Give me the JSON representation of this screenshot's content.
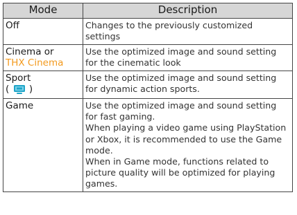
{
  "table": {
    "headers": {
      "mode": "Mode",
      "description": "Description"
    },
    "rows": [
      {
        "mode": "Off",
        "description": "Changes to the previously customized settings"
      },
      {
        "mode_line1": "Cinema or",
        "mode_line2": "THX Cinema",
        "description": "Use the optimized image and sound setting for the cinematic look"
      },
      {
        "mode_line1": "Sport",
        "mode_icon_open": "(",
        "mode_icon_close": ")",
        "icon": "sport-mode-icon",
        "description": "Use the optimized image and sound setting for dynamic action sports."
      },
      {
        "mode": "Game",
        "description_lines": [
          "Use the optimized image and sound setting for fast gaming.",
          "When playing a video game using PlayStation or Xbox, it is recommended to use the Game mode.",
          "When in Game mode, functions related to picture quality will be optimized for playing games."
        ]
      }
    ]
  },
  "colors": {
    "accent": "#f39a1e",
    "header_bg": "#d6d6d6",
    "icon": "#1fa5c8"
  }
}
